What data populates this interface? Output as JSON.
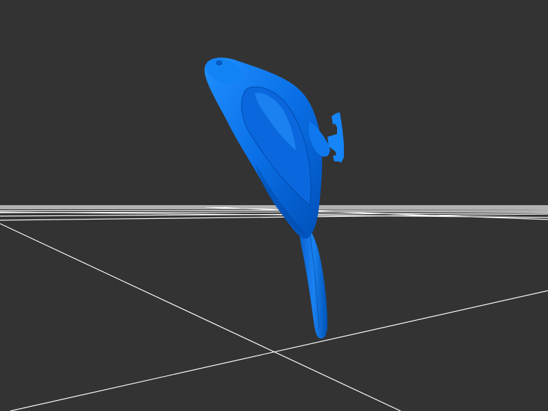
{
  "viewer": {
    "background_color": "#333333",
    "grid_color": "#ffffff",
    "model_color": "#0066dd",
    "model_highlight": "#1a8cff",
    "model_shadow": "#0047a8",
    "model_name": "bird-model"
  }
}
